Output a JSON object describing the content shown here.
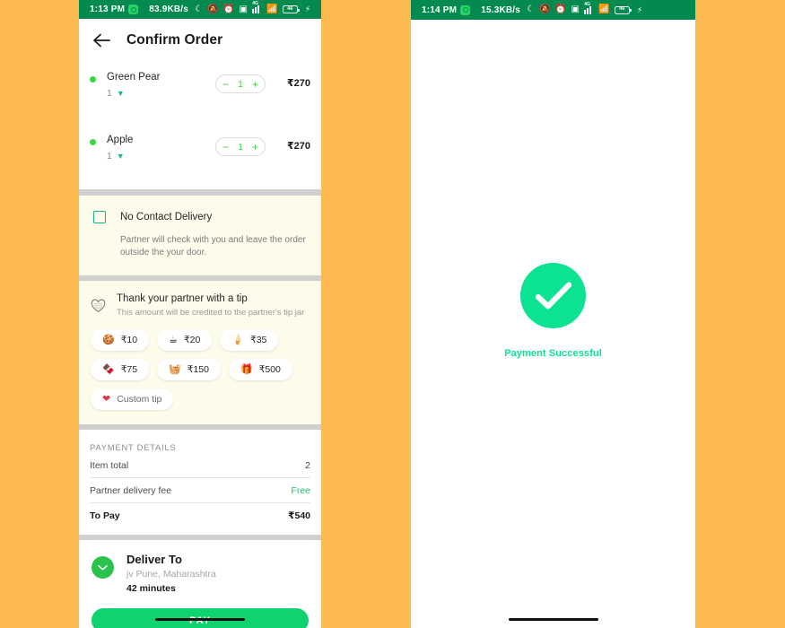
{
  "theme": {
    "background": "#FBB94F",
    "statusbar_green": "#048A4F",
    "accent_green": "#3BD642",
    "pay_button_green": "#0FD36F",
    "success_green": "#0BE292",
    "cream_card": "#FDFBEA",
    "divider_gray": "#CFCFCF"
  },
  "left_phone": {
    "statusbar": {
      "time": "1:13 PM",
      "network_speed": "83.9KB/s",
      "whatsapp_icon": "whatsapp-icon",
      "icons": [
        "moon-icon",
        "mute-icon",
        "alarm-icon",
        "screenshot-icon",
        "signal-icon",
        "wifi-icon",
        "battery-icon",
        "charging-bolt-icon"
      ],
      "signal_label": "4G",
      "battery_level": "46"
    },
    "appbar": {
      "back_icon": "back-arrow-icon",
      "title": "Confirm Order"
    },
    "items": [
      {
        "name": "Green Pear",
        "qty": "1",
        "price": "₹270",
        "veg": true,
        "stepper_minus": "−",
        "stepper_plus": "+",
        "stepper_value": "1"
      },
      {
        "name": "Apple",
        "qty": "1",
        "price": "₹270",
        "veg": true,
        "stepper_minus": "−",
        "stepper_plus": "+",
        "stepper_value": "1"
      }
    ],
    "no_contact": {
      "checkbox_checked": false,
      "title": "No Contact Delivery",
      "description": "Partner will check with you and leave the order outside the your door."
    },
    "tip": {
      "icon": "tip-heart-icon",
      "title": "Thank your partner with a tip",
      "subtitle": "This amount will be credited to the partner's tip jar",
      "options": [
        {
          "emoji": "🍪",
          "icon_name": "cookie-icon",
          "label": "₹10"
        },
        {
          "emoji": "☕",
          "icon_name": "coffee-icon",
          "label": "₹20"
        },
        {
          "emoji": "🍦",
          "icon_name": "ice-cream-icon",
          "label": "₹35"
        },
        {
          "emoji": "🍫",
          "icon_name": "chocolate-icon",
          "label": "₹75"
        },
        {
          "emoji": "🧺",
          "icon_name": "basket-icon",
          "label": "₹150"
        },
        {
          "emoji": "🎁",
          "icon_name": "gift-icon",
          "label": "₹500"
        }
      ],
      "custom": {
        "emoji": "❤",
        "icon_name": "heart-icon",
        "label": "Custom tip"
      }
    },
    "payment_details": {
      "heading": "PAYMENT DETAILS",
      "rows": [
        {
          "label": "Item total",
          "value": "2",
          "free": false
        },
        {
          "label": "Partner delivery fee",
          "value": "Free",
          "free": true
        }
      ],
      "total": {
        "label": "To Pay",
        "value": "₹540"
      }
    },
    "deliver_to": {
      "badge_icon": "chevron-down-circle-icon",
      "title": "Deliver To",
      "address": "jv Pune, Maharashtra",
      "eta": "42 minutes"
    },
    "pay_button_label": "PAY"
  },
  "right_phone": {
    "statusbar": {
      "time": "1:14 PM",
      "network_speed": "15.3KB/s",
      "whatsapp_icon": "whatsapp-icon",
      "signal_label": "4G",
      "battery_level": "46"
    },
    "success": {
      "icon": "check-circle-icon",
      "message": "Payment Successful"
    }
  }
}
